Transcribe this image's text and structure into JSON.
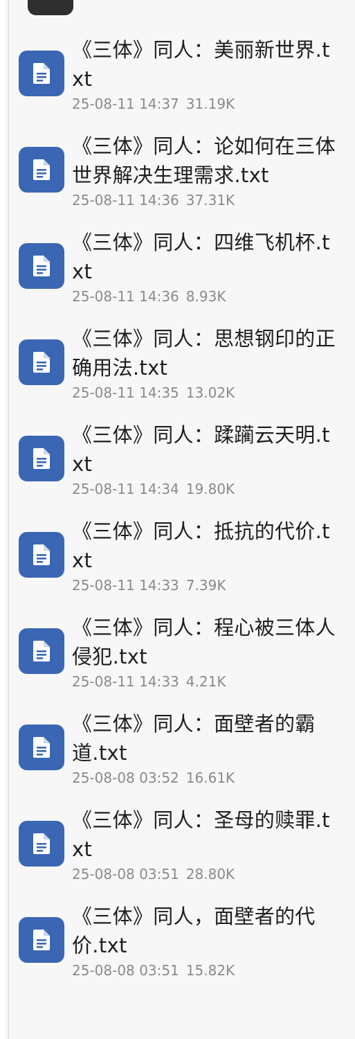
{
  "file_list": {
    "items": [
      {
        "name": "《三体》同人：美丽新世界.txt",
        "date": "25-08-11 14:37",
        "size": "31.19K"
      },
      {
        "name": "《三体》同人：论如何在三体世界解决生理需求.txt",
        "date": "25-08-11 14:36",
        "size": "37.31K"
      },
      {
        "name": "《三体》同人：四维飞机杯.txt",
        "date": "25-08-11 14:36",
        "size": "8.93K"
      },
      {
        "name": "《三体》同人：思想钢印的正确用法.txt",
        "date": "25-08-11 14:35",
        "size": "13.02K"
      },
      {
        "name": "《三体》同人：蹂躏云天明.txt",
        "date": "25-08-11 14:34",
        "size": "19.80K"
      },
      {
        "name": "《三体》同人：抵抗的代价.txt",
        "date": "25-08-11 14:33",
        "size": "7.39K"
      },
      {
        "name": "《三体》同人：程心被三体人侵犯.txt",
        "date": "25-08-11 14:33",
        "size": "4.21K"
      },
      {
        "name": "《三体》同人：面壁者的霸道.txt",
        "date": "25-08-08 03:52",
        "size": "16.61K"
      },
      {
        "name": "《三体》同人：圣母的赎罪.txt",
        "date": "25-08-08 03:51",
        "size": "28.80K"
      },
      {
        "name": "《三体》同人，面壁者的代价.txt",
        "date": "25-08-08 03:51",
        "size": "15.82K"
      }
    ]
  },
  "icons": {
    "file_icon": "document-icon"
  },
  "colors": {
    "icon_background": "#3b66b4",
    "name_text": "#1f1f1f",
    "meta_text": "#8a8a8a",
    "panel_background": "#f7f7f7"
  }
}
